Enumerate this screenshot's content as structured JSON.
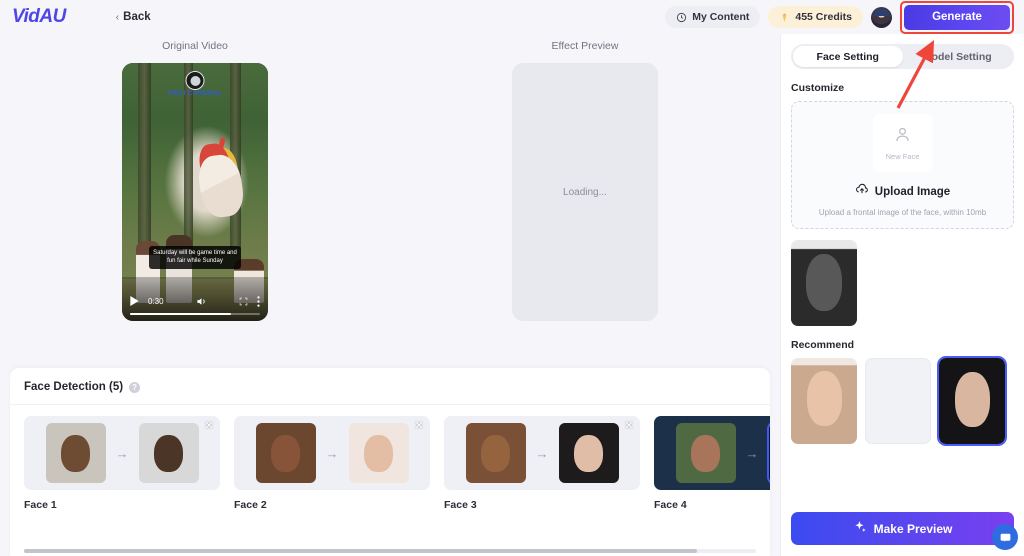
{
  "header": {
    "logo": "VidAU",
    "back_label": "Back",
    "back_icon": "chevron-left-icon",
    "my_content_label": "My Content",
    "my_content_icon": "clock-icon",
    "credits_label": "455 Credits",
    "credits_icon": "diamond-badge-icon",
    "avatar_icon": "user-avatar",
    "generate_label": "Generate",
    "generate_accent": "#5b46ef",
    "highlight_color": "#f0453a"
  },
  "preview": {
    "original_label": "Original Video",
    "effect_label": "Effect Preview",
    "loading_text": "Loading...",
    "video": {
      "watermark_text": "FIRST CARDINAL",
      "caption": "Saturday will be game time and fun fair while Sunday",
      "time": "0:30",
      "play_icon": "play-icon",
      "volume_icon": "volume-icon",
      "fullscreen_icon": "fullscreen-icon",
      "menu_icon": "more-vertical-icon"
    }
  },
  "face_detection": {
    "title": "Face Detection (5)",
    "help_icon": "help-circle-icon",
    "help_glyph": "?",
    "arrow_glyph": "→",
    "remove_glyph": "✕",
    "cards": [
      {
        "label": "Face 1",
        "selected": false,
        "source_class": "f1a",
        "target_class": "f1b"
      },
      {
        "label": "Face 2",
        "selected": false,
        "source_class": "f2a",
        "target_class": "f2b"
      },
      {
        "label": "Face 3",
        "selected": false,
        "source_class": "f3a",
        "target_class": "f3b"
      },
      {
        "label": "Face 4",
        "selected": true,
        "source_class": "f4a",
        "target_class": "f4b"
      }
    ]
  },
  "right_panel": {
    "tabs": [
      {
        "label": "Face Setting",
        "active": true
      },
      {
        "label": "Model Setting",
        "active": false
      }
    ],
    "customize_title": "Customize",
    "new_face_label": "New Face",
    "new_face_icon": "person-icon",
    "upload_label": "Upload Image",
    "upload_icon": "cloud-upload-icon",
    "upload_hint": "Upload a frontal image of the face, within 10mb",
    "recommend_title": "Recommend",
    "recommend_items": [
      {
        "selected": false,
        "art": "r1"
      },
      {
        "selected": false,
        "art": "empty"
      },
      {
        "selected": true,
        "art": "r3"
      }
    ],
    "make_preview_label": "Make Preview",
    "make_preview_icon": "sparkle-icon",
    "chat_icon": "chat-bubble-icon"
  },
  "annotation": {
    "arrow_icon": "pointer-arrow-annotation",
    "color": "#f0453a"
  }
}
